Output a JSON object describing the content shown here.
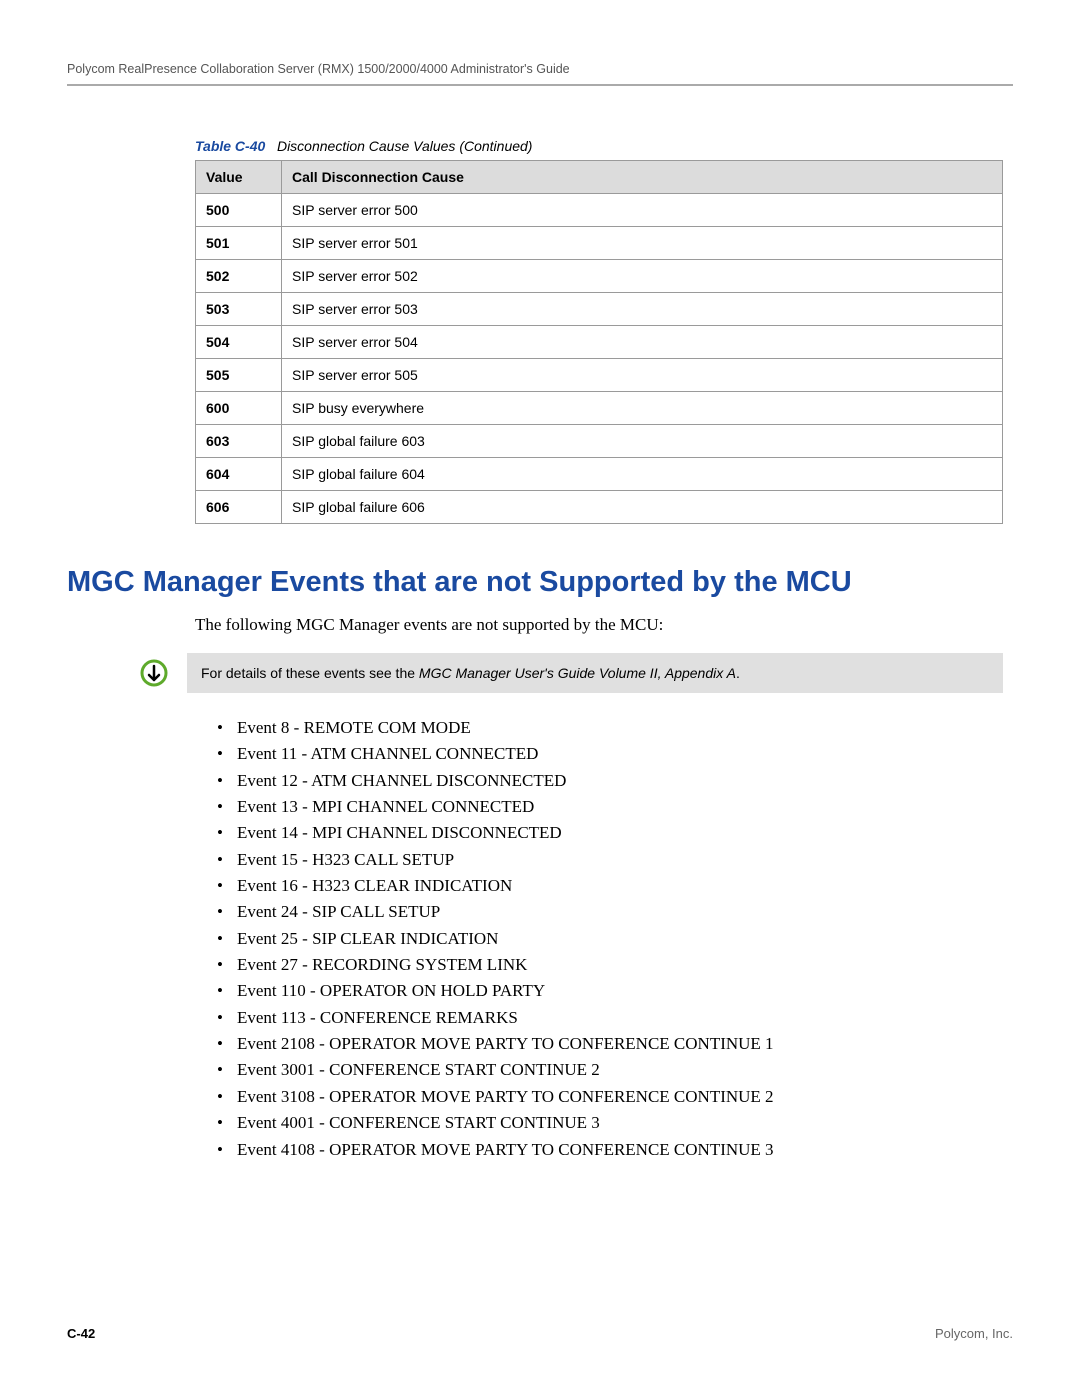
{
  "header": {
    "title": "Polycom RealPresence Collaboration Server (RMX) 1500/2000/4000 Administrator's Guide"
  },
  "table": {
    "caption_label": "Table C-40",
    "caption_text": "Disconnection Cause Values (Continued)",
    "headers": {
      "value": "Value",
      "cause": "Call Disconnection Cause"
    },
    "rows": [
      {
        "value": "500",
        "cause": "SIP server error 500"
      },
      {
        "value": "501",
        "cause": "SIP server error 501"
      },
      {
        "value": "502",
        "cause": "SIP server error 502"
      },
      {
        "value": "503",
        "cause": "SIP server error 503"
      },
      {
        "value": "504",
        "cause": "SIP server error 504"
      },
      {
        "value": "505",
        "cause": "SIP server error 505"
      },
      {
        "value": "600",
        "cause": "SIP busy everywhere"
      },
      {
        "value": "603",
        "cause": "SIP global failure 603"
      },
      {
        "value": "604",
        "cause": "SIP global failure 604"
      },
      {
        "value": "606",
        "cause": "SIP global failure 606"
      }
    ]
  },
  "section": {
    "heading": "MGC Manager Events that are not Supported by the MCU",
    "intro": "The following MGC Manager events are not supported by the MCU:",
    "note_prefix": "For details of these events see the ",
    "note_ref": "MGC Manager User's Guide Volume II, Appendix A",
    "note_suffix": ".",
    "events": [
      "Event 8 - REMOTE COM MODE",
      "Event 11 - ATM CHANNEL CONNECTED",
      "Event 12 - ATM CHANNEL DISCONNECTED",
      "Event 13 - MPI CHANNEL CONNECTED",
      "Event 14 - MPI CHANNEL DISCONNECTED",
      "Event 15 - H323 CALL SETUP",
      "Event 16 - H323 CLEAR INDICATION",
      "Event 24 - SIP CALL SETUP",
      "Event 25 - SIP CLEAR INDICATION",
      "Event 27 - RECORDING SYSTEM LINK",
      "Event 110 - OPERATOR ON HOLD PARTY",
      "Event 113 - CONFERENCE REMARKS",
      "Event 2108 - OPERATOR MOVE PARTY TO CONFERENCE CONTINUE 1",
      "Event 3001 - CONFERENCE START CONTINUE 2",
      "Event 3108 - OPERATOR MOVE PARTY TO CONFERENCE CONTINUE 2",
      "Event 4001 - CONFERENCE START CONTINUE 3",
      "Event 4108 - OPERATOR MOVE PARTY TO CONFERENCE CONTINUE 3"
    ]
  },
  "footer": {
    "page_number": "C-42",
    "company": "Polycom, Inc."
  }
}
